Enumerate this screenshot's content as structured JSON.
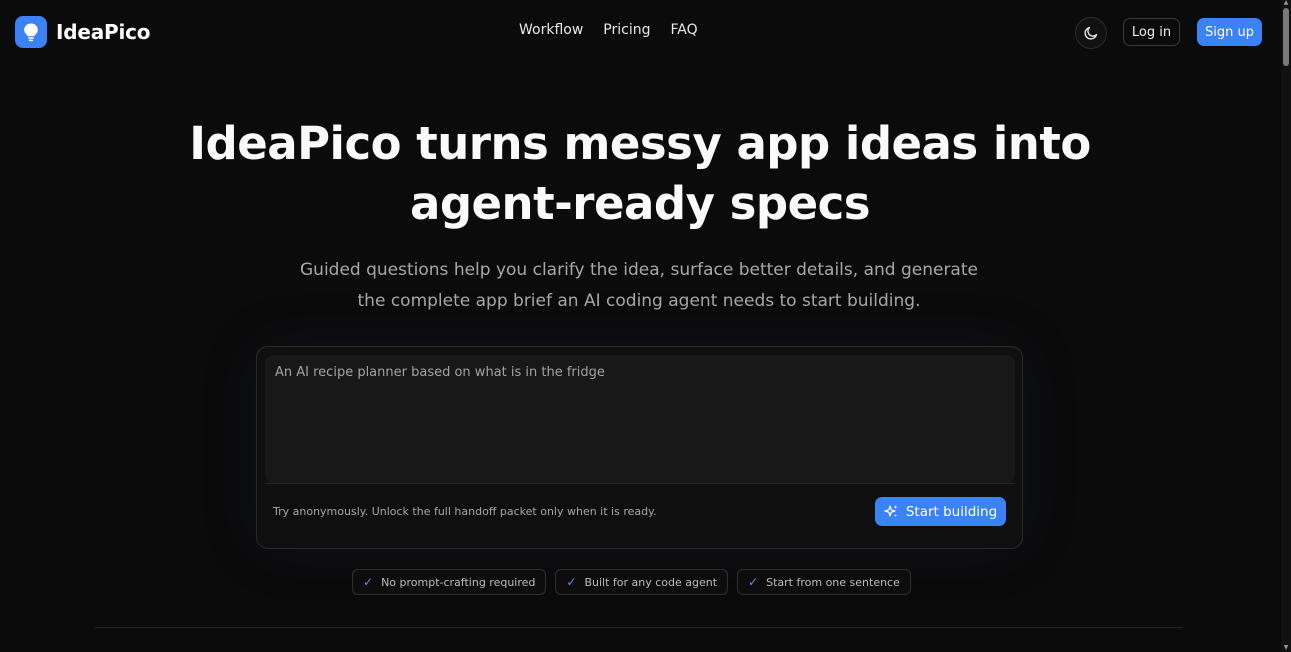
{
  "header": {
    "brand": "IdeaPico",
    "nav": [
      "Workflow",
      "Pricing",
      "FAQ"
    ],
    "login_label": "Log in",
    "signup_label": "Sign up"
  },
  "hero": {
    "title_line1": "IdeaPico turns messy app ideas into",
    "title_line2": "agent-ready specs",
    "subtitle_line1": "Guided questions help you clarify the idea, surface better details, and generate",
    "subtitle_line2": "the complete app brief an AI coding agent needs to start building."
  },
  "composer": {
    "placeholder": "An AI recipe planner based on what is in the fridge",
    "note": "Try anonymously. Unlock the full handoff packet only when it is ready.",
    "submit_label": "Start building"
  },
  "features": [
    "No prompt-crafting required",
    "Built for any code agent",
    "Start from one sentence"
  ],
  "colors": {
    "background": "#0b0b0b",
    "accent": "#3b82f6",
    "muted_text": "#a8a8a8"
  },
  "icons": {
    "logo": "lightbulb-icon",
    "theme": "moon-icon",
    "submit": "sparkles-icon",
    "feature": "check-icon"
  }
}
